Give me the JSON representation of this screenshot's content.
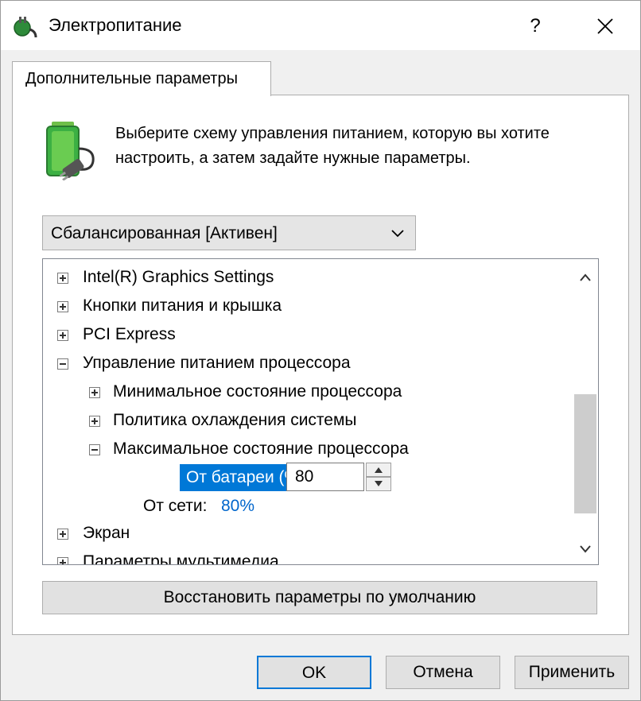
{
  "window": {
    "title": "Электропитание",
    "help_label": "?"
  },
  "tabs": [
    {
      "label": "Дополнительные параметры"
    }
  ],
  "description": "Выберите схему управления питанием, которую вы хотите настроить, а затем задайте нужные параметры.",
  "plan_select": {
    "value": "Сбалансированная [Активен]"
  },
  "tree": {
    "items": [
      {
        "label": "Intel(R) Graphics Settings",
        "expanded": false
      },
      {
        "label": "Кнопки питания и крышка",
        "expanded": false
      },
      {
        "label": "PCI Express",
        "expanded": false
      },
      {
        "label": "Управление питанием процессора",
        "expanded": true
      },
      {
        "label": "Минимальное состояние процессора",
        "expanded": false
      },
      {
        "label": "Политика охлаждения системы",
        "expanded": false
      },
      {
        "label": "Максимальное состояние процессора",
        "expanded": true
      },
      {
        "label": "Экран",
        "expanded": false
      },
      {
        "label": "Параметры мультимедиа",
        "expanded": false
      }
    ],
    "battery_label": "От батареи (%):",
    "battery_value": "80",
    "ac_label": "От сети:",
    "ac_value": "80%"
  },
  "buttons": {
    "restore": "Восстановить параметры по умолчанию",
    "ok": "OK",
    "cancel": "Отмена",
    "apply": "Применить"
  },
  "colors": {
    "selection": "#0078d7",
    "link_value": "#0066cc",
    "battery_green": "#3cb043"
  }
}
